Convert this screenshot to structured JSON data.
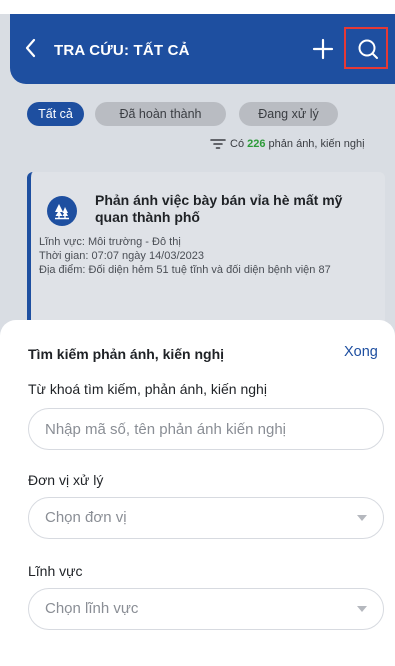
{
  "header": {
    "title": "TRA CỨU: TẤT CẢ",
    "back_icon": "chevron-left-icon",
    "add_icon": "plus-icon",
    "search_icon": "search-icon",
    "color": "#1e4fa0"
  },
  "filters": {
    "chips": [
      "Tất cả",
      "Đã hoàn thành",
      "Đang xử lý"
    ],
    "count_prefix": "Có",
    "count_value": "226",
    "count_suffix": "phản ánh, kiến nghị"
  },
  "card": {
    "title": "Phản ánh việc bày bán vỉa hè mất mỹ quan thành phố",
    "field": "Lĩnh vực: Môi trường - Đô thị",
    "time": "Thời gian: 07:07 ngày 14/03/2023",
    "location": "Địa điểm: Đối diện hẻm 51 tuệ tĩnh và đối diện bệnh viện 87"
  },
  "sheet": {
    "title": "Tìm kiếm phản ánh, kiến nghị",
    "done_label": "Xong",
    "keyword_label": "Từ khoá tìm kiếm, phản ánh, kiến nghị",
    "keyword_placeholder": "Nhập mã số, tên phản ánh kiến nghị",
    "unit_label": "Đơn vị xử lý",
    "unit_value": "Chọn đơn vị",
    "field_label": "Lĩnh vực",
    "field_value": "Chọn lĩnh vực"
  }
}
